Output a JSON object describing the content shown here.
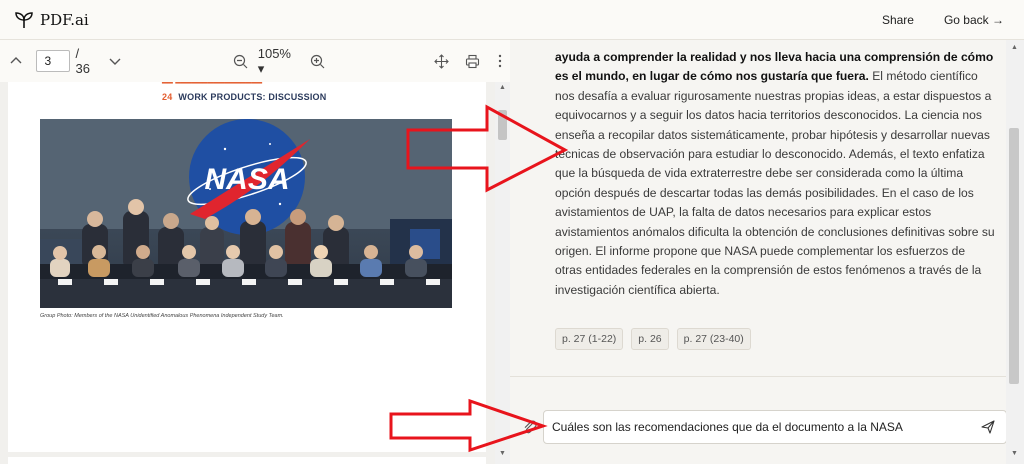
{
  "header": {
    "logo_text": "PDF.ai",
    "share_label": "Share",
    "go_back_label": "Go back →"
  },
  "pdf_toolbar": {
    "page_value": "3",
    "page_total": "/ 36",
    "zoom_value": "105% ▾"
  },
  "pdf_page": {
    "toc_number": "24",
    "toc_text": "WORK PRODUCTS: DISCUSSION",
    "photo_logo_text": "NASA",
    "caption": "Group Photo: Members of the NASA Unidentified Anomalous Phenomena Independent Study Team."
  },
  "chat": {
    "answer_bold": "ayuda a comprender la realidad y nos lleva hacia una comprensión de cómo es el mundo, en lugar de cómo nos gustaría que fuera.",
    "answer_rest": " El método científico nos desafía a evaluar rigurosamente nuestras propias ideas, a estar dispuestos a equivocarnos y a seguir los datos hacia territorios desconocidos. La ciencia nos enseña a recopilar datos sistemáticamente, probar hipótesis y desarrollar nuevas técnicas de observación para estudiar lo desconocido. Además, el texto enfatiza que la búsqueda de vida extraterrestre debe ser considerada como la última opción después de descartar todas las demás posibilidades. En el caso de los avistamientos de UAP, la falta de datos necesarios para explicar estos avistamientos anómalos dificulta la obtención de conclusiones definitivas sobre su origen. El informe propone que NASA puede complementar los esfuerzos de otras entidades federales en la comprensión de estos fenómenos a través de la investigación científica abierta.",
    "citations": [
      "p. 27 (1-22)",
      "p. 26",
      "p. 27 (23-40)"
    ],
    "input_value": "Cuáles son las recomendaciones que da el documento a la NASA"
  },
  "colors": {
    "annotation_red": "#e8141c",
    "toc_orange": "#e35d2f",
    "nasa_blue": "#1f4fa3"
  },
  "icons": [
    "sprout-logo-icon",
    "chevron-up-icon",
    "chevron-down-icon",
    "zoom-out-icon",
    "zoom-in-icon",
    "move-icon",
    "print-icon",
    "more-vertical-icon",
    "paperclip-icon",
    "send-icon"
  ]
}
